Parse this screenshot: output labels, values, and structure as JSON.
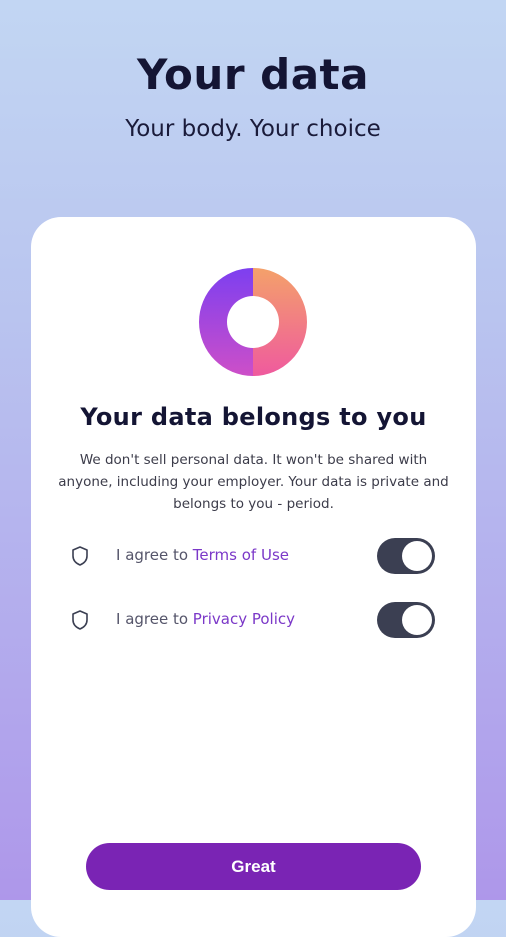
{
  "header": {
    "title": "Your data",
    "subtitle": "Your body. Your choice"
  },
  "card": {
    "logo_icon": "donut-logo-icon",
    "title": "Your data belongs to you",
    "description": "We don't sell personal data. It won't be shared with anyone, including your employer. Your data is private and belongs to you - period.",
    "agreements": [
      {
        "icon": "shield-icon",
        "prefix": "I agree to ",
        "link": "Terms of Use",
        "enabled": true
      },
      {
        "icon": "shield-icon",
        "prefix": "I agree to ",
        "link": "Privacy Policy",
        "enabled": true
      }
    ],
    "button_label": "Great"
  },
  "colors": {
    "accent": "#7a24b4",
    "link": "#7b38c8",
    "toggle_on": "#3b3f52",
    "title": "#141534"
  }
}
